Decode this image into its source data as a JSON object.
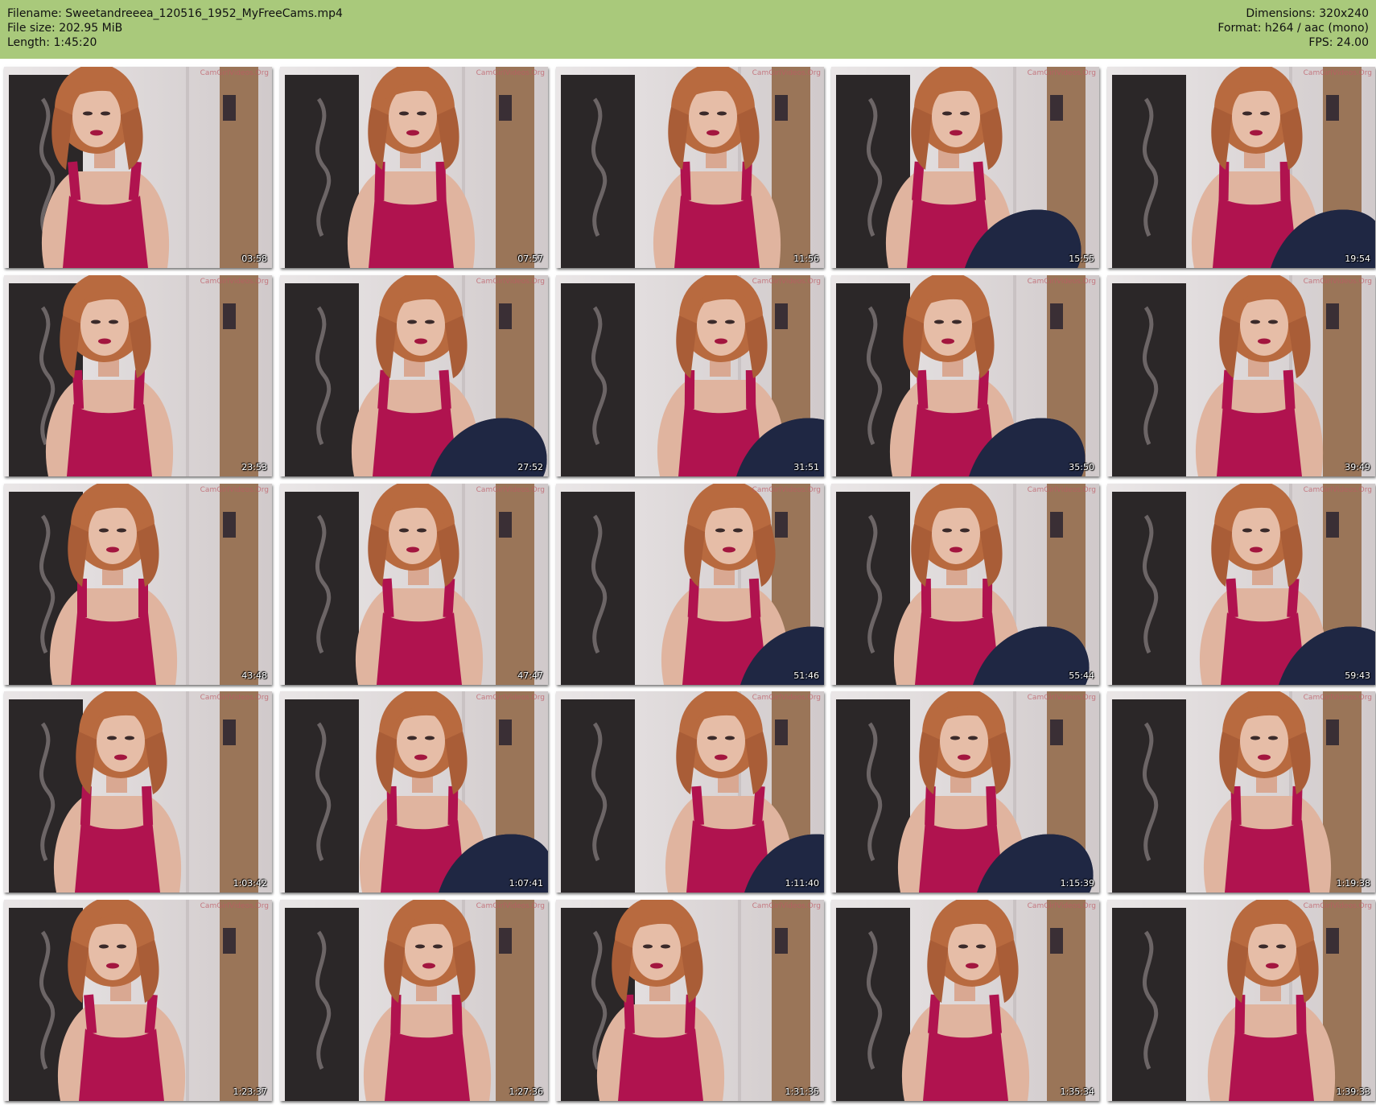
{
  "header": {
    "filename_label": "Filename: Sweetandreeea_120516_1952_MyFreeCams.mp4",
    "filesize_label": "File size: 202.95 MiB",
    "length_label": "Length: 1:45:20",
    "dimensions_label": "Dimensions: 320x240",
    "format_label": "Format: h264 / aac (mono)",
    "fps_label": "FPS: 24.00"
  },
  "watermark": "CamGirlVideos.Org",
  "colors": {
    "header_bg": "#a9c97b",
    "top_color": "#b0134f",
    "wall": "#dcd6d7",
    "door": "#2b2728",
    "hair": "#b86a3f",
    "jeans": "#1f2743"
  },
  "thumbnails": [
    {
      "time": "03:58",
      "legs": false
    },
    {
      "time": "07:57",
      "legs": false
    },
    {
      "time": "11:56",
      "legs": false
    },
    {
      "time": "15:55",
      "legs": true
    },
    {
      "time": "19:54",
      "legs": true
    },
    {
      "time": "23:53",
      "legs": false
    },
    {
      "time": "27:52",
      "legs": true
    },
    {
      "time": "31:51",
      "legs": true
    },
    {
      "time": "35:50",
      "legs": true
    },
    {
      "time": "39:49",
      "legs": false
    },
    {
      "time": "43:48",
      "legs": false
    },
    {
      "time": "47:47",
      "legs": false
    },
    {
      "time": "51:46",
      "legs": true
    },
    {
      "time": "55:44",
      "legs": true
    },
    {
      "time": "59:43",
      "legs": true
    },
    {
      "time": "1:03:42",
      "legs": false
    },
    {
      "time": "1:07:41",
      "legs": true
    },
    {
      "time": "1:11:40",
      "legs": true
    },
    {
      "time": "1:15:39",
      "legs": true
    },
    {
      "time": "1:19:38",
      "legs": false
    },
    {
      "time": "1:23:37",
      "legs": false
    },
    {
      "time": "1:27:36",
      "legs": false
    },
    {
      "time": "1:31:35",
      "legs": false
    },
    {
      "time": "1:35:34",
      "legs": false
    },
    {
      "time": "1:39:33",
      "legs": false
    }
  ]
}
